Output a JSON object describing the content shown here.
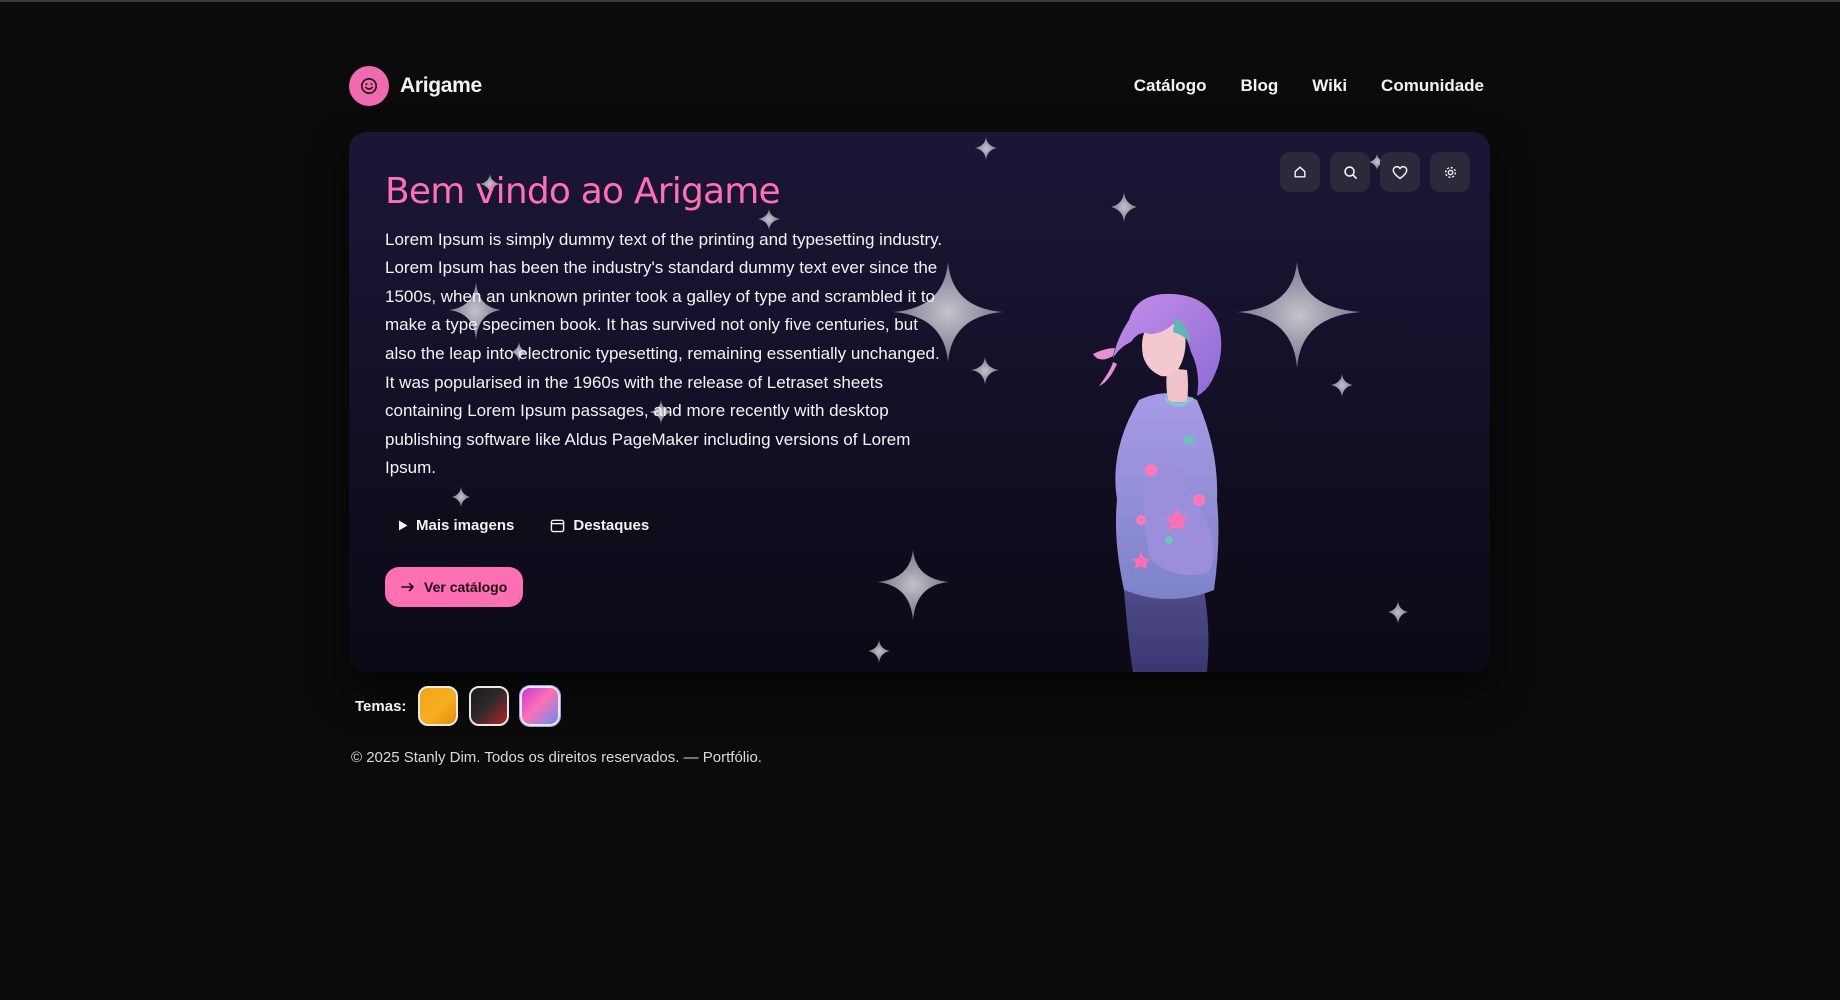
{
  "header": {
    "brand": "Arigame",
    "nav": [
      "Catálogo",
      "Blog",
      "Wiki",
      "Comunidade"
    ]
  },
  "hero": {
    "title": "Bem vindo ao Arigame",
    "text": "Lorem Ipsum is simply dummy text of the printing and typesetting industry. Lorem Ipsum has been the industry's standard dummy text ever since the 1500s, when an unknown printer took a galley of type and scrambled it to make a type specimen book. It has survived not only five centuries, but also the leap into electronic typesetting, remaining essentially unchanged. It was popularised in the 1960s with the release of Letraset sheets containing Lorem Ipsum passages, and more recently with desktop publishing software like Aldus PageMaker including versions of Lorem Ipsum.",
    "chips": [
      {
        "label": "Mais imagens",
        "icon": "play-icon"
      },
      {
        "label": "Destaques",
        "icon": "calendar-icon"
      }
    ],
    "cta": {
      "label": "Ver catálogo",
      "icon": "arrow-right-icon"
    },
    "toolbar": [
      "home-icon",
      "search-icon",
      "heart-icon",
      "gear-icon"
    ]
  },
  "themes": {
    "label": "Temas:",
    "swatches": [
      "orange-gradient",
      "dark-red-gradient",
      "pink-blue-gradient"
    ],
    "active": "pink-blue-gradient"
  },
  "footer": {
    "text": "© 2025 Stanly Dim. Todos os direitos reservados. — Portfólio."
  },
  "colors": {
    "accent": "#ff6fb3",
    "background": "#0b0b0b",
    "hero_top": "#1b1636"
  }
}
